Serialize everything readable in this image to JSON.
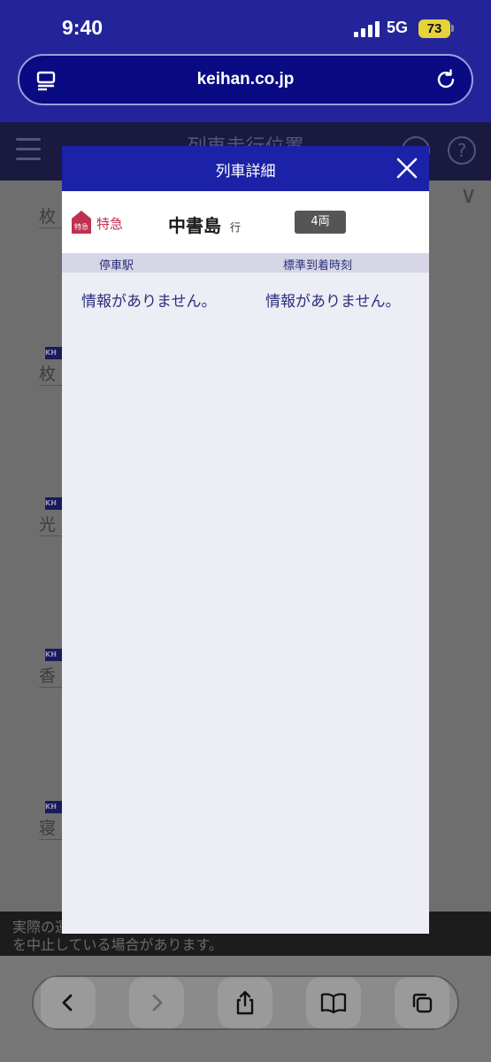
{
  "status_bar": {
    "time": "9:40",
    "network": "5G",
    "battery": "73"
  },
  "browser": {
    "url": "keihan.co.jp"
  },
  "page": {
    "title": "列車走行位置",
    "background_stations": [
      "枚",
      "枚",
      "光",
      "香",
      "寝"
    ],
    "kh_badge": "KH",
    "notice_line1": "実際の運行状況と異なる場合があります。一部のサービス",
    "notice_line2": "を中止している場合があります。"
  },
  "modal": {
    "title": "列車詳細",
    "train_type": "特急",
    "train_type_badge": "特急",
    "destination": "中書島",
    "destination_suffix": "行",
    "cars": "4両",
    "column_station": "停車駅",
    "column_time": "標準到着時刻",
    "no_info_station": "情報がありません。",
    "no_info_time": "情報がありません。"
  },
  "colors": {
    "header_blue": "#1b22a8",
    "limited_express": "#c0304f",
    "text_navy": "#2c2f7c"
  }
}
